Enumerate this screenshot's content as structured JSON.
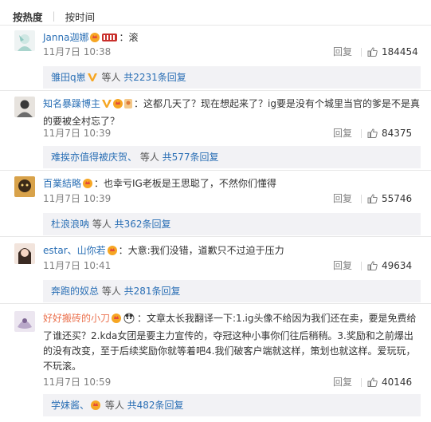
{
  "sort": {
    "hot_label": "按热度",
    "time_label": "按时间"
  },
  "comments": [
    {
      "username": "Janna迦娜",
      "text": "：滚",
      "date": "11月7日 10:38",
      "reply_label": "回复",
      "likes": "184454",
      "sub": {
        "user": "雏田q崽",
        "plain": " 等人 ",
        "link": "共2231条回复"
      }
    },
    {
      "username": "知名暴躁博主",
      "text": "：这都几天了？现在想起来了？ig要是没有个城里当官的爹是不是真的要被全村忘了？",
      "date": "11月7日 10:39",
      "reply_label": "回复",
      "likes": "84375",
      "sub": {
        "user": "难挨亦值得被庆贺、",
        "plain": " 等人 ",
        "link": "共577条回复"
      }
    },
    {
      "username": "百業結略",
      "text": "：也幸亏IG老板是王思聪了，不然你们懂得",
      "date": "11月7日 10:39",
      "reply_label": "回复",
      "likes": "55746",
      "sub": {
        "user": "杜浪浪呐",
        "plain": " 等人 ",
        "link": "共362条回复"
      }
    },
    {
      "username": "estar、山你若",
      "text": "：大意:我们没错，道歉只不过迫于压力",
      "date": "11月7日 10:41",
      "reply_label": "回复",
      "likes": "49634",
      "sub": {
        "user": "奔跑的奴总",
        "plain": " 等人 ",
        "link": "共281条回复"
      }
    },
    {
      "username": "好好搬砖的小刀",
      "text": "：文章太长我翻译一下:1.ig头像不给因为我们还在卖，要是免费给了谁还买？2.kda女团是要主力宣传的，夺冠这种小事你们往后稍稍。3.奖励和之前爆出的没有改变，至于后续奖励你就等着吧4.我们破客户端就这样，策划也就这样。爱玩玩，不玩滚。",
      "date": "11月7日 10:59",
      "reply_label": "回复",
      "likes": "40146",
      "sub": {
        "user": "学妹酱、",
        "plain": " 等人 ",
        "link": "共482条回复"
      }
    }
  ],
  "colors": {
    "username_orange": "#eb7350",
    "link_blue": "#2a6fb5",
    "sub_bg": "#f2f2f5"
  }
}
